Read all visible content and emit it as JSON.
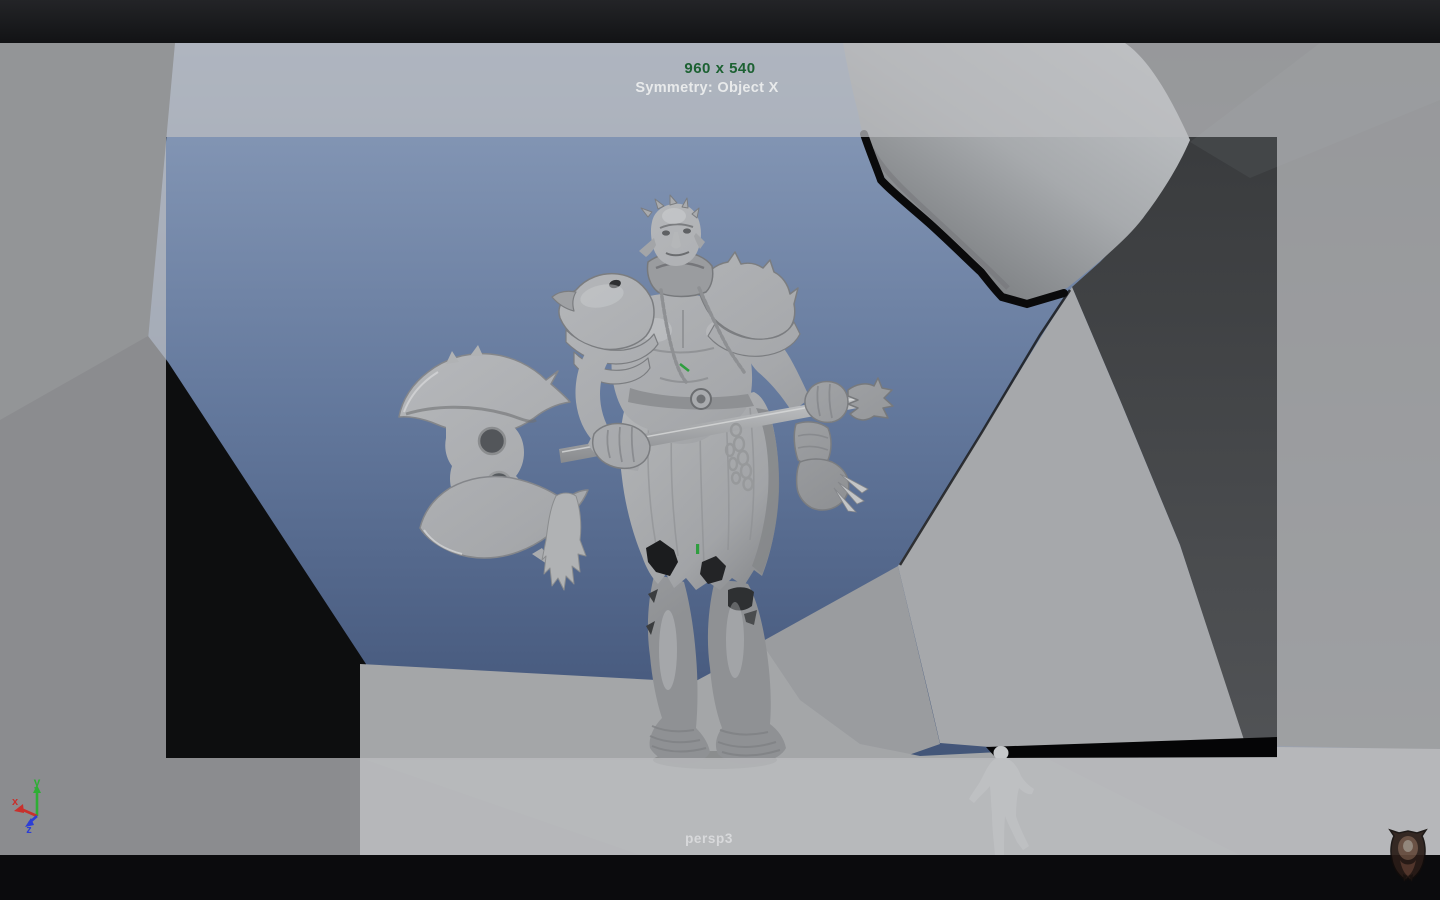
{
  "hud": {
    "resolution": "960 x 540",
    "symmetry": "Symmetry: Object X",
    "camera": "persp3"
  },
  "axis_gizmo": {
    "x": "x",
    "y": "y",
    "z": "z"
  },
  "colors": {
    "resolution_text": "#1c6132",
    "symmetry_text": "#ecedee",
    "camera_text": "#d8d9db",
    "axis_x": "#c9302c",
    "axis_y": "#2eae35",
    "axis_z": "#2c3ed6",
    "selection_highlight": "#2f9e3f",
    "sky_top": "#8a9db9",
    "sky_bottom": "#3c4e6f",
    "gate_mask": "rgba(188,190,193,0.72)"
  }
}
